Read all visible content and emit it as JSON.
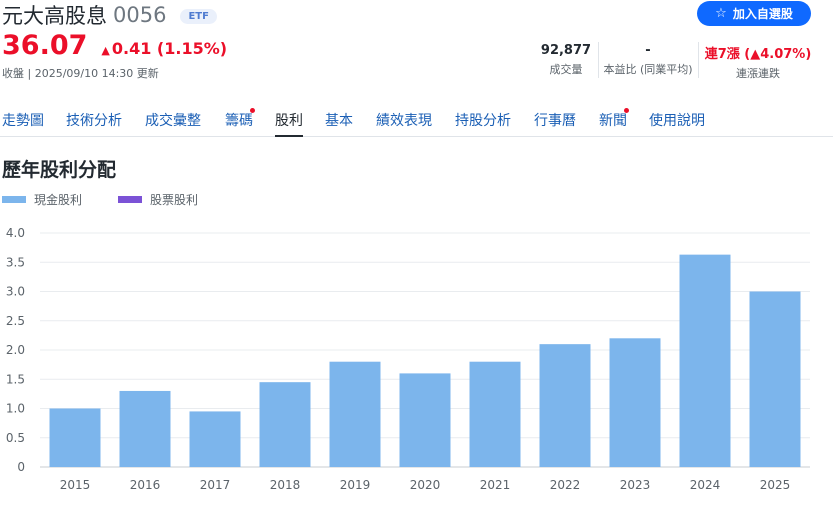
{
  "header": {
    "name": "元大高股息",
    "code": "0056",
    "badge": "ETF",
    "follow_label": "加入自選股",
    "price": "36.07",
    "change": "0.41 (1.15%)",
    "update_time": "收盤 | 2025/09/10 14:30 更新",
    "stats": [
      {
        "value": "92,877",
        "label": "成交量"
      },
      {
        "value": "-",
        "label": "本益比 (同業平均)"
      },
      {
        "value": "連7漲 (▲4.07%)",
        "label": "連漲連跌"
      }
    ]
  },
  "nav": {
    "items": [
      "走勢圖",
      "技術分析",
      "成交彙整",
      "籌碼",
      "股利",
      "基本",
      "績效表現",
      "持股分析",
      "行事曆",
      "新聞",
      "使用說明"
    ],
    "active": "股利"
  },
  "section": {
    "title": "歷年股利分配",
    "legend": [
      "現金股利",
      "股票股利"
    ]
  },
  "colors": {
    "cash": "#7cb5ec",
    "stock": "#7b52d6",
    "accent": "#0f69ff",
    "up": "#eb0f29"
  },
  "chart_data": {
    "type": "bar",
    "categories": [
      "2015",
      "2016",
      "2017",
      "2018",
      "2019",
      "2020",
      "2021",
      "2022",
      "2023",
      "2024",
      "2025"
    ],
    "series": [
      {
        "name": "現金股利",
        "values": [
          1.0,
          1.3,
          0.95,
          1.45,
          1.8,
          1.6,
          1.8,
          2.1,
          2.2,
          3.63,
          3.0
        ]
      },
      {
        "name": "股票股利",
        "values": [
          0,
          0,
          0,
          0,
          0,
          0,
          0,
          0,
          0,
          0,
          0
        ]
      }
    ],
    "yticks": [
      "0",
      "0.5",
      "1.0",
      "1.5",
      "2.0",
      "2.5",
      "3.0",
      "3.5",
      "4.0"
    ],
    "ylim": [
      0,
      4.0
    ],
    "grid": true,
    "legend_position": "top-left"
  }
}
